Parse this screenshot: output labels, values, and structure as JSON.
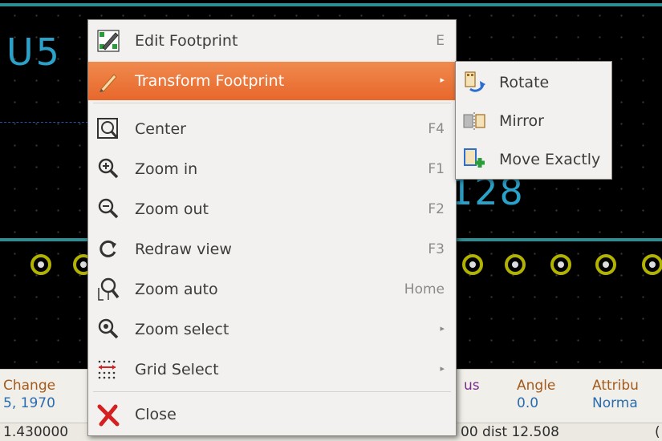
{
  "canvas": {
    "ref_top": "U5",
    "ref_value": "128"
  },
  "context_menu": {
    "items": [
      {
        "label": "Edit Footprint",
        "shortcut": "E",
        "icon": "edit-footprint-icon"
      },
      {
        "label": "Transform Footprint",
        "shortcut": "",
        "icon": "pencil-icon",
        "submenu": true,
        "highlighted": true
      },
      {
        "label": "Center",
        "shortcut": "F4",
        "icon": "center-icon"
      },
      {
        "label": "Zoom in",
        "shortcut": "F1",
        "icon": "zoom-in-icon"
      },
      {
        "label": "Zoom out",
        "shortcut": "F2",
        "icon": "zoom-out-icon"
      },
      {
        "label": "Redraw view",
        "shortcut": "F3",
        "icon": "redraw-icon"
      },
      {
        "label": "Zoom auto",
        "shortcut": "Home",
        "icon": "zoom-auto-icon"
      },
      {
        "label": "Zoom select",
        "shortcut": "",
        "icon": "zoom-select-icon",
        "submenu": true
      },
      {
        "label": "Grid Select",
        "shortcut": "",
        "icon": "grid-select-icon",
        "submenu": true
      },
      {
        "label": "Close",
        "shortcut": "",
        "icon": "close-icon"
      }
    ]
  },
  "submenu": {
    "items": [
      {
        "label": "Rotate",
        "icon": "rotate-icon"
      },
      {
        "label": "Mirror",
        "icon": "mirror-icon"
      },
      {
        "label": "Move Exactly",
        "icon": "move-exactly-icon"
      }
    ]
  },
  "status_bar": {
    "col1_label": "Change",
    "col1_value": "5, 1970",
    "status_label": "us",
    "angle_label": "Angle",
    "angle_value": "0.0",
    "attrib_label": "Attribu",
    "attrib_value": "Norma",
    "coord_left": "1.430000",
    "coord_right": "00  dist 12.508",
    "trail": "("
  },
  "colors": {
    "accent": "#e8672b",
    "track": "#2c8f95",
    "ref_text": "#2aa1c8",
    "pad": "#b2b200"
  }
}
